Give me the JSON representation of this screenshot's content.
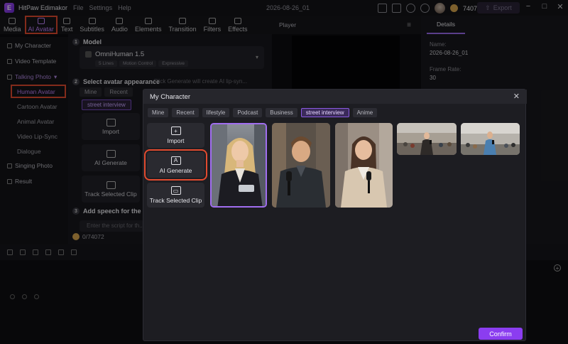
{
  "app": {
    "name": "HitPaw Edimakor",
    "menu": [
      "File",
      "Settings",
      "Help"
    ],
    "filename": "2026-08-26_01",
    "credits": "74072",
    "export_label": "Export"
  },
  "toolbar": {
    "tabs": [
      {
        "label": "Media"
      },
      {
        "label": "AI Avatar",
        "active": true
      },
      {
        "label": "Text"
      },
      {
        "label": "Subtitles"
      },
      {
        "label": "Audio"
      },
      {
        "label": "Elements"
      },
      {
        "label": "Transition"
      },
      {
        "label": "Filters"
      },
      {
        "label": "Effects"
      }
    ]
  },
  "sidebar": {
    "items": [
      {
        "label": "My Character"
      },
      {
        "label": "Video Template"
      },
      {
        "label": "Talking Photo"
      },
      {
        "label": "Human Avatar"
      },
      {
        "label": "Cartoon Avatar"
      },
      {
        "label": "Animal Avatar"
      },
      {
        "label": "Video Lip-Sync"
      },
      {
        "label": "Dialogue"
      },
      {
        "label": "Singing Photo"
      },
      {
        "label": "Result"
      }
    ]
  },
  "panel": {
    "step1_title": "Model",
    "model_name": "OmniHuman 1.5",
    "model_tags": [
      "5 Lines",
      "Motion Control",
      "Expressive"
    ],
    "step2_title": "Select avatar appearance",
    "step2_hint": "Click Generate will create AI lip-syn...",
    "chips": [
      "Mine",
      "Recent"
    ],
    "active_chip": "street interview",
    "import_label": "Import",
    "ai_generate_label": "AI Generate",
    "track_label": "Track Selected Clip",
    "step3_title": "Add speech for the Cha...",
    "speech_placeholder": "Enter the script for th...",
    "credit_value": "0/74072"
  },
  "player": {
    "title": "Player"
  },
  "details": {
    "tab": "Details",
    "name_label": "Name:",
    "name_value": "2026-08-26_01",
    "frame_rate_label": "Frame Rate:",
    "frame_rate_value": "30"
  },
  "modal": {
    "title": "My Character",
    "tabs": [
      {
        "label": "Mine"
      },
      {
        "label": "Recent"
      },
      {
        "label": "lifestyle"
      },
      {
        "label": "Podcast"
      },
      {
        "label": "Business"
      },
      {
        "label": "street interview",
        "active": true
      },
      {
        "label": "Anime"
      }
    ],
    "import_label": "Import",
    "ai_generate_label": "AI Generate",
    "track_label": "Track Selected Clip",
    "confirm_label": "Confirm"
  },
  "colors": {
    "accent": "#8b3df0",
    "highlight": "#e24b2f",
    "active_tab_text": "#c084fc"
  }
}
